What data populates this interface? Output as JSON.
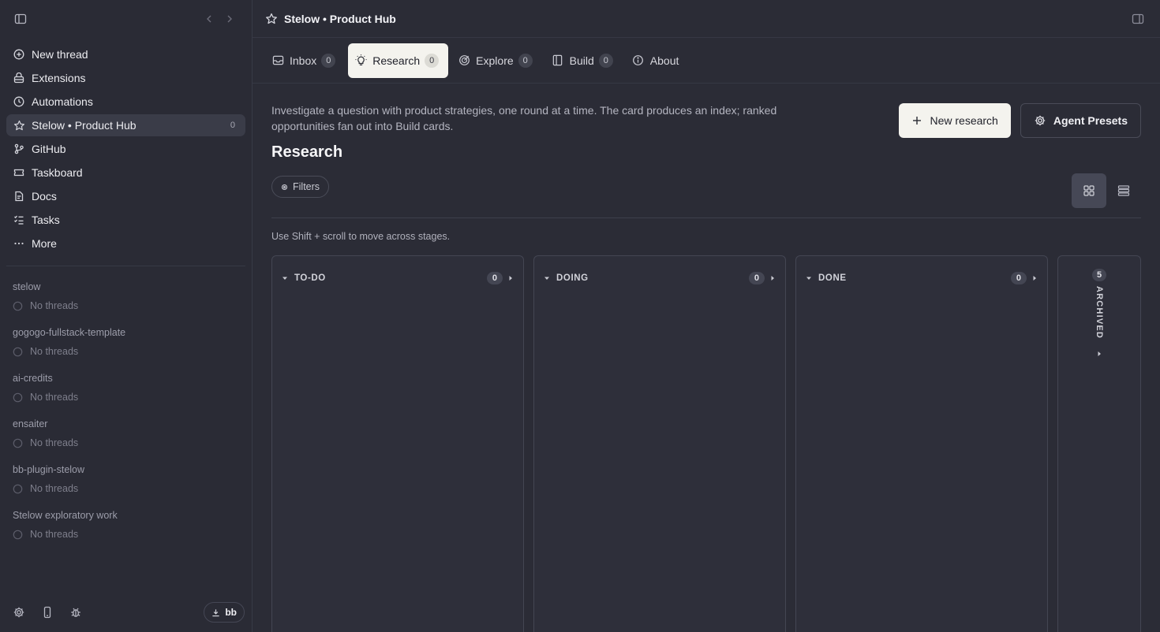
{
  "sidebar": {
    "nav": [
      {
        "label": "New thread",
        "icon": "new-thread-icon"
      },
      {
        "label": "Extensions",
        "icon": "extensions-icon"
      },
      {
        "label": "Automations",
        "icon": "clock-icon"
      },
      {
        "label": "Stelow • Product Hub",
        "icon": "star-icon",
        "count": "0",
        "active": true
      },
      {
        "label": "GitHub",
        "icon": "github-icon"
      },
      {
        "label": "Taskboard",
        "icon": "ticket-icon"
      },
      {
        "label": "Docs",
        "icon": "doc-icon"
      },
      {
        "label": "Tasks",
        "icon": "checklist-icon"
      },
      {
        "label": "More",
        "icon": "more-icon"
      }
    ],
    "groups": [
      {
        "title": "stelow",
        "empty": "No threads"
      },
      {
        "title": "gogogo-fullstack-template",
        "empty": "No threads"
      },
      {
        "title": "ai-credits",
        "empty": "No threads"
      },
      {
        "title": "ensaiter",
        "empty": "No threads"
      },
      {
        "title": "bb-plugin-stelow",
        "empty": "No threads"
      },
      {
        "title": "Stelow exploratory work",
        "empty": "No threads"
      }
    ],
    "user_label": "bb"
  },
  "header": {
    "title": "Stelow • Product Hub"
  },
  "tabs": [
    {
      "label": "Inbox",
      "badge": "0"
    },
    {
      "label": "Research",
      "badge": "0",
      "active": true
    },
    {
      "label": "Explore",
      "badge": "0"
    },
    {
      "label": "Build",
      "badge": "0"
    },
    {
      "label": "About"
    }
  ],
  "content": {
    "description": "Investigate a question with product strategies, one round at a time. The card produces an index; ranked opportunities fan out into Build cards.",
    "new_research_label": "New research",
    "agent_presets_label": "Agent Presets",
    "title": "Research",
    "filters_label": "Filters",
    "hint": "Use Shift + scroll to move across stages."
  },
  "board": {
    "columns": [
      {
        "label": "TO-DO",
        "count": "0"
      },
      {
        "label": "DOING",
        "count": "0"
      },
      {
        "label": "DONE",
        "count": "0"
      }
    ],
    "archived": {
      "label": "ARCHIVED",
      "count": "5"
    }
  },
  "colors": {
    "background": "#2b2c36",
    "sidebar": "#2a2b35",
    "active_tab": "#f4f3ee",
    "primary_button": "#f4f3ee"
  }
}
